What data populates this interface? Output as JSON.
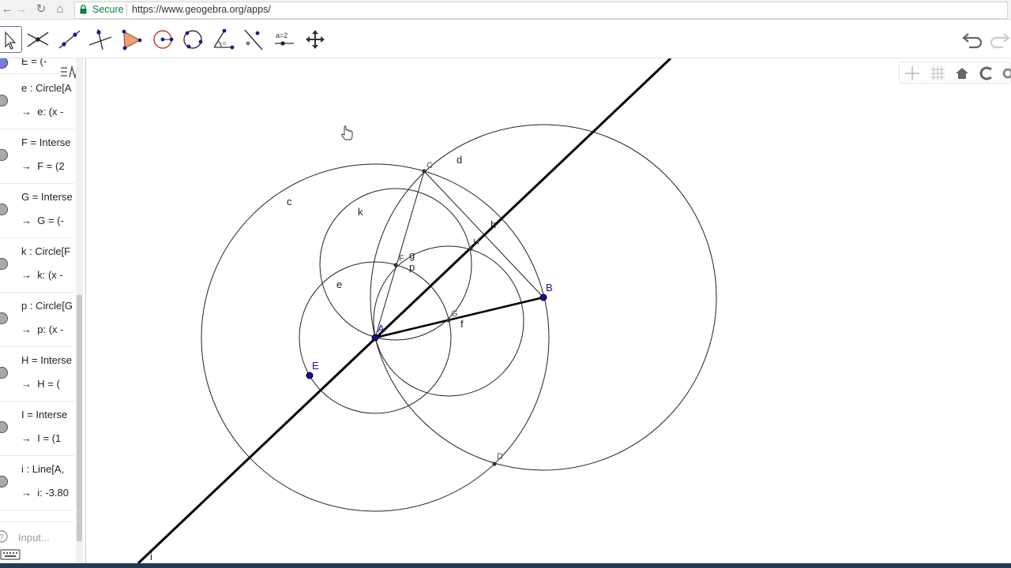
{
  "browser": {
    "secure_label": "Secure",
    "url": "https://www.geogebra.org/apps/",
    "icons": [
      "back-icon",
      "forward-icon",
      "reload-icon",
      "home-icon",
      "lock-icon"
    ]
  },
  "toolbar": {
    "tools": [
      "move",
      "point",
      "line",
      "perpendicular-line",
      "polygon",
      "circle-center-point",
      "circle-three-points",
      "angle",
      "reflect",
      "slider",
      "move-graphics-view"
    ],
    "slider_label": "a=2"
  },
  "algebra": {
    "items": [
      {
        "def": "E = (-",
        "val": ""
      },
      {
        "def": "e : Circle[A",
        "val": "e: (x -"
      },
      {
        "def": "F = Interse",
        "val": "F = (2"
      },
      {
        "def": "G = Interse",
        "val": "G = (-"
      },
      {
        "def": "k : Circle[F",
        "val": "k: (x -"
      },
      {
        "def": "p : Circle[G",
        "val": "p: (x -"
      },
      {
        "def": "H = Interse",
        "val": "H = ("
      },
      {
        "def": "I = Interse",
        "val": "I = (1"
      },
      {
        "def": "i : Line[A,",
        "val": "i: -3.80"
      }
    ],
    "arrow": "→",
    "input_placeholder": "Input..."
  },
  "graphics": {
    "labels": {
      "c": "c",
      "d": "d",
      "k": "k",
      "e": "e",
      "g": "g",
      "p": "p",
      "f": "f",
      "h": "h",
      "i": "i",
      "A": "A",
      "B": "B",
      "C": "C",
      "D": "D",
      "E": "E",
      "F": "F",
      "G": "G",
      "H": "H"
    },
    "colors": {
      "free_point": "#1010a8",
      "line": "#000000",
      "dependent_point": "#333333"
    }
  }
}
